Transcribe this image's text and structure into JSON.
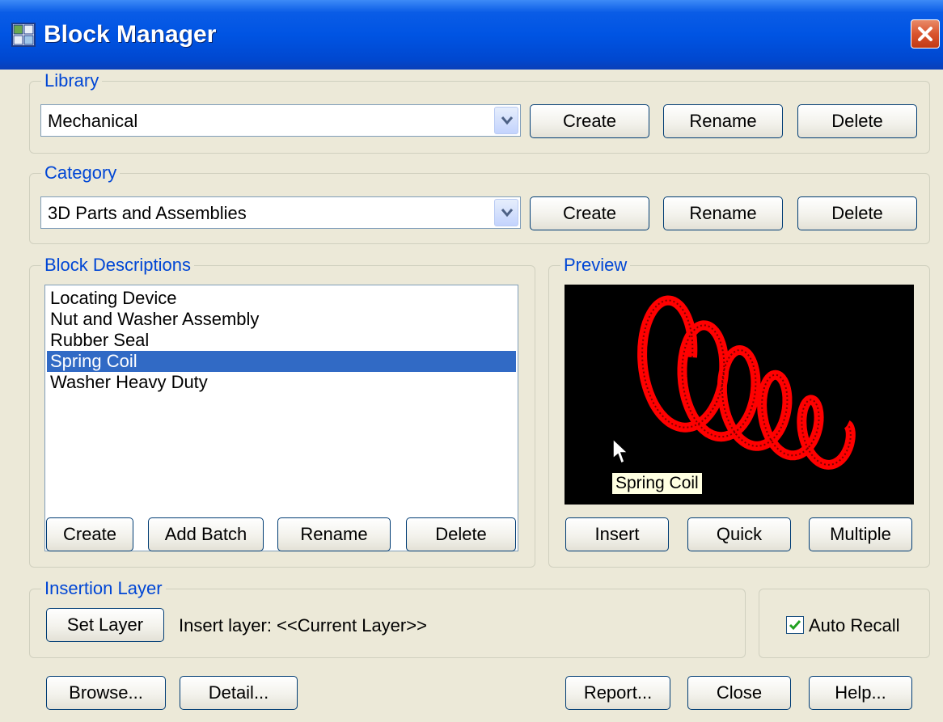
{
  "window": {
    "title": "Block Manager",
    "icon": "block-manager-app-icon",
    "close_icon": "close-icon"
  },
  "library": {
    "legend": "Library",
    "selected": "Mechanical",
    "buttons": {
      "create": "Create",
      "rename": "Rename",
      "delete": "Delete"
    }
  },
  "category": {
    "legend": "Category",
    "selected": "3D Parts and Assemblies",
    "buttons": {
      "create": "Create",
      "rename": "Rename",
      "delete": "Delete"
    }
  },
  "blocks": {
    "legend": "Block Descriptions",
    "items": [
      "Locating Device",
      "Nut and Washer Assembly",
      "Rubber Seal",
      "Spring Coil",
      "Washer Heavy Duty"
    ],
    "selected_index": 3,
    "buttons": {
      "create": "Create",
      "add_batch": "Add Batch",
      "rename": "Rename",
      "delete": "Delete"
    }
  },
  "preview": {
    "legend": "Preview",
    "tooltip": "Spring Coil",
    "buttons": {
      "insert": "Insert",
      "quick": "Quick",
      "multiple": "Multiple"
    },
    "coil_color": "#ff0000"
  },
  "insertion_layer": {
    "legend": "Insertion Layer",
    "set_layer": "Set Layer",
    "status": "Insert layer: <<Current Layer>>"
  },
  "auto_recall": {
    "label": "Auto Recall",
    "checked": true
  },
  "footer": {
    "browse": "Browse...",
    "detail": "Detail...",
    "report": "Report...",
    "close": "Close",
    "help": "Help..."
  },
  "colors": {
    "titlebar": "#0054e3",
    "legend": "#0046d5",
    "selection": "#316ac5",
    "face": "#ece9d8"
  }
}
